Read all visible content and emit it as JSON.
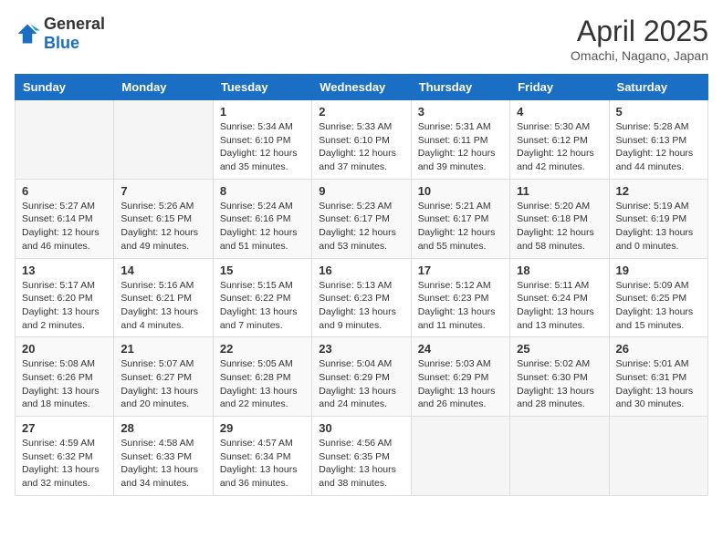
{
  "logo": {
    "general": "General",
    "blue": "Blue"
  },
  "title": "April 2025",
  "location": "Omachi, Nagano, Japan",
  "weekdays": [
    "Sunday",
    "Monday",
    "Tuesday",
    "Wednesday",
    "Thursday",
    "Friday",
    "Saturday"
  ],
  "weeks": [
    [
      {
        "day": "",
        "sunrise": "",
        "sunset": "",
        "daylight": ""
      },
      {
        "day": "",
        "sunrise": "",
        "sunset": "",
        "daylight": ""
      },
      {
        "day": "1",
        "sunrise": "Sunrise: 5:34 AM",
        "sunset": "Sunset: 6:10 PM",
        "daylight": "Daylight: 12 hours and 35 minutes."
      },
      {
        "day": "2",
        "sunrise": "Sunrise: 5:33 AM",
        "sunset": "Sunset: 6:10 PM",
        "daylight": "Daylight: 12 hours and 37 minutes."
      },
      {
        "day": "3",
        "sunrise": "Sunrise: 5:31 AM",
        "sunset": "Sunset: 6:11 PM",
        "daylight": "Daylight: 12 hours and 39 minutes."
      },
      {
        "day": "4",
        "sunrise": "Sunrise: 5:30 AM",
        "sunset": "Sunset: 6:12 PM",
        "daylight": "Daylight: 12 hours and 42 minutes."
      },
      {
        "day": "5",
        "sunrise": "Sunrise: 5:28 AM",
        "sunset": "Sunset: 6:13 PM",
        "daylight": "Daylight: 12 hours and 44 minutes."
      }
    ],
    [
      {
        "day": "6",
        "sunrise": "Sunrise: 5:27 AM",
        "sunset": "Sunset: 6:14 PM",
        "daylight": "Daylight: 12 hours and 46 minutes."
      },
      {
        "day": "7",
        "sunrise": "Sunrise: 5:26 AM",
        "sunset": "Sunset: 6:15 PM",
        "daylight": "Daylight: 12 hours and 49 minutes."
      },
      {
        "day": "8",
        "sunrise": "Sunrise: 5:24 AM",
        "sunset": "Sunset: 6:16 PM",
        "daylight": "Daylight: 12 hours and 51 minutes."
      },
      {
        "day": "9",
        "sunrise": "Sunrise: 5:23 AM",
        "sunset": "Sunset: 6:17 PM",
        "daylight": "Daylight: 12 hours and 53 minutes."
      },
      {
        "day": "10",
        "sunrise": "Sunrise: 5:21 AM",
        "sunset": "Sunset: 6:17 PM",
        "daylight": "Daylight: 12 hours and 55 minutes."
      },
      {
        "day": "11",
        "sunrise": "Sunrise: 5:20 AM",
        "sunset": "Sunset: 6:18 PM",
        "daylight": "Daylight: 12 hours and 58 minutes."
      },
      {
        "day": "12",
        "sunrise": "Sunrise: 5:19 AM",
        "sunset": "Sunset: 6:19 PM",
        "daylight": "Daylight: 13 hours and 0 minutes."
      }
    ],
    [
      {
        "day": "13",
        "sunrise": "Sunrise: 5:17 AM",
        "sunset": "Sunset: 6:20 PM",
        "daylight": "Daylight: 13 hours and 2 minutes."
      },
      {
        "day": "14",
        "sunrise": "Sunrise: 5:16 AM",
        "sunset": "Sunset: 6:21 PM",
        "daylight": "Daylight: 13 hours and 4 minutes."
      },
      {
        "day": "15",
        "sunrise": "Sunrise: 5:15 AM",
        "sunset": "Sunset: 6:22 PM",
        "daylight": "Daylight: 13 hours and 7 minutes."
      },
      {
        "day": "16",
        "sunrise": "Sunrise: 5:13 AM",
        "sunset": "Sunset: 6:23 PM",
        "daylight": "Daylight: 13 hours and 9 minutes."
      },
      {
        "day": "17",
        "sunrise": "Sunrise: 5:12 AM",
        "sunset": "Sunset: 6:23 PM",
        "daylight": "Daylight: 13 hours and 11 minutes."
      },
      {
        "day": "18",
        "sunrise": "Sunrise: 5:11 AM",
        "sunset": "Sunset: 6:24 PM",
        "daylight": "Daylight: 13 hours and 13 minutes."
      },
      {
        "day": "19",
        "sunrise": "Sunrise: 5:09 AM",
        "sunset": "Sunset: 6:25 PM",
        "daylight": "Daylight: 13 hours and 15 minutes."
      }
    ],
    [
      {
        "day": "20",
        "sunrise": "Sunrise: 5:08 AM",
        "sunset": "Sunset: 6:26 PM",
        "daylight": "Daylight: 13 hours and 18 minutes."
      },
      {
        "day": "21",
        "sunrise": "Sunrise: 5:07 AM",
        "sunset": "Sunset: 6:27 PM",
        "daylight": "Daylight: 13 hours and 20 minutes."
      },
      {
        "day": "22",
        "sunrise": "Sunrise: 5:05 AM",
        "sunset": "Sunset: 6:28 PM",
        "daylight": "Daylight: 13 hours and 22 minutes."
      },
      {
        "day": "23",
        "sunrise": "Sunrise: 5:04 AM",
        "sunset": "Sunset: 6:29 PM",
        "daylight": "Daylight: 13 hours and 24 minutes."
      },
      {
        "day": "24",
        "sunrise": "Sunrise: 5:03 AM",
        "sunset": "Sunset: 6:29 PM",
        "daylight": "Daylight: 13 hours and 26 minutes."
      },
      {
        "day": "25",
        "sunrise": "Sunrise: 5:02 AM",
        "sunset": "Sunset: 6:30 PM",
        "daylight": "Daylight: 13 hours and 28 minutes."
      },
      {
        "day": "26",
        "sunrise": "Sunrise: 5:01 AM",
        "sunset": "Sunset: 6:31 PM",
        "daylight": "Daylight: 13 hours and 30 minutes."
      }
    ],
    [
      {
        "day": "27",
        "sunrise": "Sunrise: 4:59 AM",
        "sunset": "Sunset: 6:32 PM",
        "daylight": "Daylight: 13 hours and 32 minutes."
      },
      {
        "day": "28",
        "sunrise": "Sunrise: 4:58 AM",
        "sunset": "Sunset: 6:33 PM",
        "daylight": "Daylight: 13 hours and 34 minutes."
      },
      {
        "day": "29",
        "sunrise": "Sunrise: 4:57 AM",
        "sunset": "Sunset: 6:34 PM",
        "daylight": "Daylight: 13 hours and 36 minutes."
      },
      {
        "day": "30",
        "sunrise": "Sunrise: 4:56 AM",
        "sunset": "Sunset: 6:35 PM",
        "daylight": "Daylight: 13 hours and 38 minutes."
      },
      {
        "day": "",
        "sunrise": "",
        "sunset": "",
        "daylight": ""
      },
      {
        "day": "",
        "sunrise": "",
        "sunset": "",
        "daylight": ""
      },
      {
        "day": "",
        "sunrise": "",
        "sunset": "",
        "daylight": ""
      }
    ]
  ]
}
